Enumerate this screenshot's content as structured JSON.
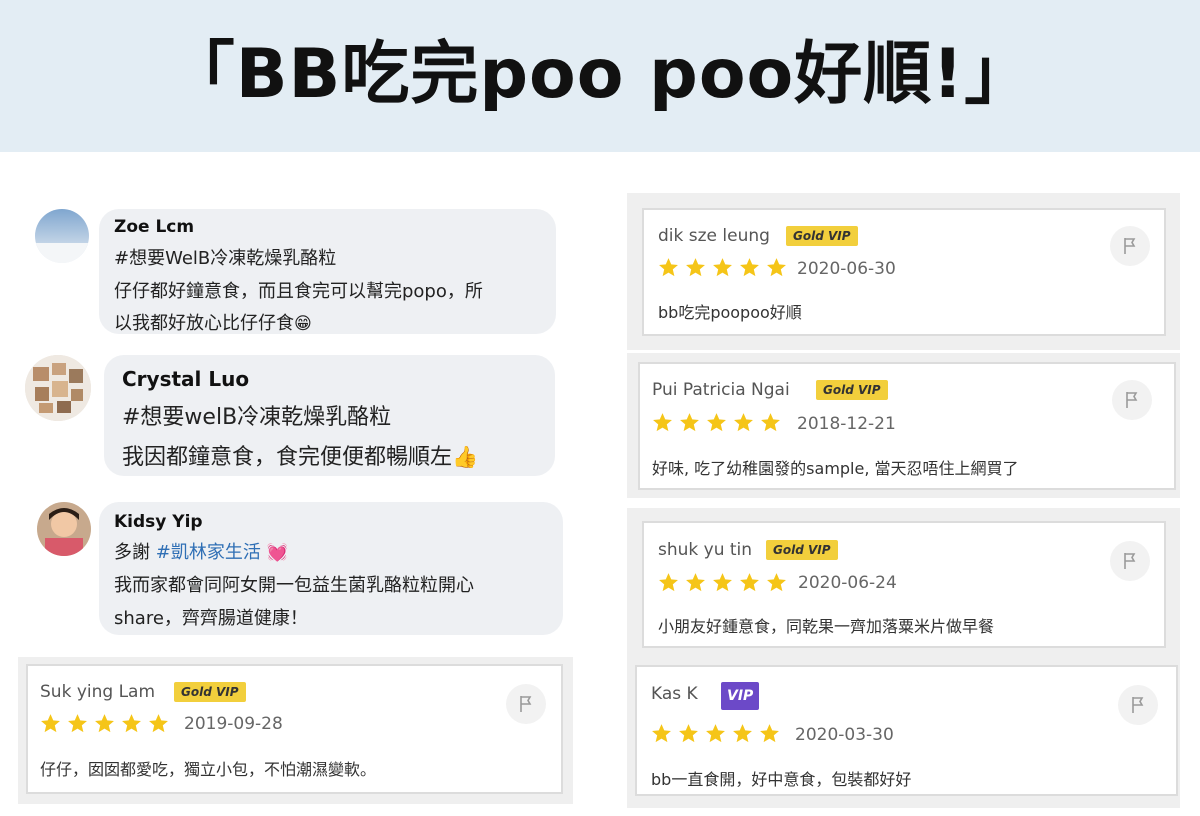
{
  "header": {
    "title": "「BB吃完poo poo好順!」"
  },
  "comments": [
    {
      "name": "Zoe Lcm",
      "hashtag": "#想要WelB冷凍乾燥乳酪粒",
      "line1": "仔仔都好鐘意食，而且食完可以幫完popo，所",
      "line2": "以我都好放心比仔仔食",
      "emoji": "😁"
    },
    {
      "name": "Crystal Luo",
      "hashtag": "#想要welB冷凍乾燥乳酪粒",
      "line1": "我因都鐘意食，食完便便都暢順左",
      "emoji": "👍"
    },
    {
      "name": "Kidsy Yip",
      "prefix": "多謝 ",
      "hashtag": "#凱林家生活",
      "emoji": "💓",
      "line1": "我而家都會同阿女開一包益生菌乳酪粒粒開心",
      "line2": "share，齊齊腸道健康！"
    }
  ],
  "reviews": [
    {
      "name": "dik sze leung",
      "badge": "Gold VIP",
      "date": "2020-06-30",
      "text": "bb吃完poopoo好順",
      "stars": 5
    },
    {
      "name": "Pui Patricia Ngai",
      "badge": "Gold VIP",
      "date": "2018-12-21",
      "text": "好味, 吃了幼稚園發的sample, 當天忍唔住上網買了",
      "stars": 5
    },
    {
      "name": "shuk yu tin",
      "badge": "Gold VIP",
      "date": "2020-06-24",
      "text": "小朋友好鍾意食，同乾果一齊加落粟米片做早餐",
      "stars": 5
    },
    {
      "name": "Kas K",
      "badge": "VIP",
      "date": "2020-03-30",
      "text": "bb一直食開，好中意食，包裝都好好",
      "stars": 5
    },
    {
      "name": "Suk ying Lam",
      "badge": "Gold VIP",
      "date": "2019-09-28",
      "text": "仔仔，囡囡都愛吃，獨立小包，不怕潮濕變軟。",
      "stars": 5
    }
  ],
  "colors": {
    "header_bg": "#e3edf4",
    "hashtag": "#2f6fb5",
    "star": "#f5c518",
    "gold_badge": "#f2cf3c",
    "vip_badge": "#6c49c8"
  },
  "icons": {
    "flag": "flag-icon",
    "star": "star-icon",
    "avatar": "avatar"
  }
}
